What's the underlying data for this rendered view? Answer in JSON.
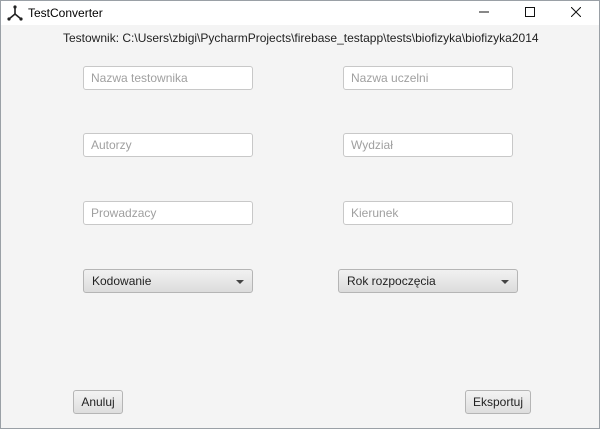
{
  "window": {
    "title": "TestConverter",
    "icon": "app-logo-icon",
    "controls": [
      "minimize-icon",
      "maximize-icon",
      "close-icon"
    ]
  },
  "path_label": "Testownik: C:\\Users\\zbigi\\PycharmProjects\\firebase_testapp\\tests\\biofizyka\\biofizyka2014",
  "fields": {
    "nazwa_testownika": {
      "placeholder": "Nazwa testownika",
      "value": ""
    },
    "nazwa_uczelni": {
      "placeholder": "Nazwa uczelni",
      "value": ""
    },
    "autorzy": {
      "placeholder": "Autorzy",
      "value": ""
    },
    "wydzial": {
      "placeholder": "Wydział",
      "value": ""
    },
    "prowadzacy": {
      "placeholder": "Prowadzacy",
      "value": ""
    },
    "kierunek": {
      "placeholder": "Kierunek",
      "value": ""
    }
  },
  "combos": {
    "kodowanie": {
      "selected": "Kodowanie"
    },
    "rok_rozpoczecia": {
      "selected": "Rok rozpoczęcia"
    }
  },
  "buttons": {
    "cancel_label": "Anuluj",
    "export_label": "Eksportuj"
  },
  "colors": {
    "window_bg": "#f4f4f4",
    "titlebar_bg": "#ffffff",
    "field_border": "#c8c8c8",
    "placeholder_text": "#a0a0a0"
  }
}
